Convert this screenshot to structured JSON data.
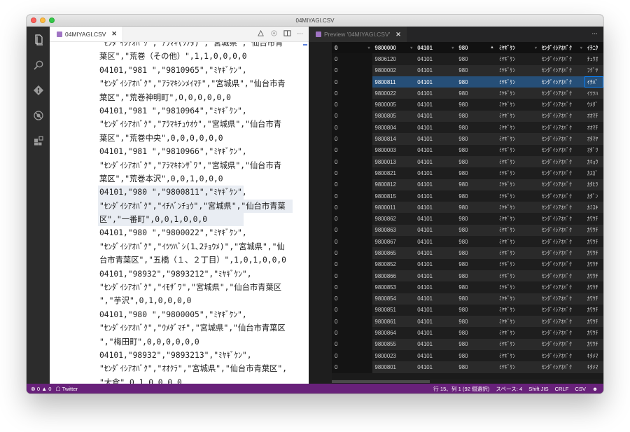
{
  "window": {
    "title": "04MIYAGI.CSV"
  },
  "activity_bar": {
    "icons": [
      "files-icon",
      "search-icon",
      "source-control-icon",
      "debug-icon",
      "extensions-icon"
    ]
  },
  "left_editor": {
    "tab_label": "04MIYAGI.CSV",
    "tab_close": "✕",
    "actions_more": "···",
    "lines": [
      "\"ｾﾝﾀﾞｲｼｱｵﾊﾞｸ\",\"ｱﾗﾏｷ(ｿﾉﾀ)\",\"宮城県\",\"仙台市青",
      "葉区\",\"荒巻（その他）\",1,1,0,0,0,0",
      "04101,\"981  \",\"9810965\",\"ﾐﾔｷﾞｹﾝ\",",
      "\"ｾﾝﾀﾞｲｼｱｵﾊﾞｸ\",\"ｱﾗﾏｷｼﾝﾒｲﾏﾁ\",\"宮城県\",\"仙台市青",
      "葉区\",\"荒巻神明町\",0,0,0,0,0,0",
      "04101,\"981  \",\"9810964\",\"ﾐﾔｷﾞｹﾝ\",",
      "\"ｾﾝﾀﾞｲｼｱｵﾊﾞｸ\",\"ｱﾗﾏｷﾁｭｳｵｳ\",\"宮城県\",\"仙台市青",
      "葉区\",\"荒巻中央\",0,0,0,0,0,0",
      "04101,\"981  \",\"9810966\",\"ﾐﾔｷﾞｹﾝ\",",
      "\"ｾﾝﾀﾞｲｼｱｵﾊﾞｸ\",\"ｱﾗﾏｷﾎﾝｻﾞﾜ\",\"宮城県\",\"仙台市青",
      "葉区\",\"荒巻本沢\",0,0,1,0,0,0",
      "04101,\"980  \",\"9800811\",\"ﾐﾔｷﾞｹﾝ\",",
      "\"ｾﾝﾀﾞｲｼｱｵﾊﾞｸ\",\"ｲﾁﾊﾞﾝﾁｮｳ\",\"宮城県\",\"仙台市青葉",
      "区\",\"一番町\",0,0,1,0,0,0",
      "04101,\"980  \",\"9800022\",\"ﾐﾔｷﾞｹﾝ\",",
      "\"ｾﾝﾀﾞｲｼｱｵﾊﾞｸ\",\"ｲﾂﾂﾊﾞｼ(1､2ﾁｮｳﾒ)\",\"宮城県\",\"仙",
      "台市青葉区\",\"五橋（１、２丁目）\",1,0,1,0,0,0",
      "04101,\"98932\",\"9893212\",\"ﾐﾔｷﾞｹﾝ\",",
      "\"ｾﾝﾀﾞｲｼｱｵﾊﾞｸ\",\"ｲﾓｻﾞﾜ\",\"宮城県\",\"仙台市青葉区",
      "\",\"芋沢\",0,1,0,0,0,0",
      "04101,\"980  \",\"9800005\",\"ﾐﾔｷﾞｹﾝ\",",
      "\"ｾﾝﾀﾞｲｼｱｵﾊﾞｸ\",\"ｳﾒﾀﾞﾏﾁ\",\"宮城県\",\"仙台市青葉区",
      "\",\"梅田町\",0,0,0,0,0,0",
      "04101,\"98932\",\"9893213\",\"ﾐﾔｷﾞｹﾝ\",",
      "\"ｾﾝﾀﾞｲｼｱｵﾊﾞｸ\",\"ｵｵｸﾗ\",\"宮城県\",\"仙台市青葉区\",",
      "\"大倉\",0,1,0,0,0,0",
      "04101,\"980  \",\"9800805\",\"ﾐﾔｷﾞｹﾝ\","
    ]
  },
  "right_editor": {
    "tab_label": "Preview '04MIYAGI.CSV'",
    "tab_close": "✕",
    "actions_more": "···",
    "headers": [
      "0",
      "9800000",
      "04101",
      "980",
      "ﾐﾔｷﾞｹﾝ",
      "ｾﾝﾀﾞｲｼｱｵﾊﾞｸ",
      "ｲﾁﾆｸ"
    ],
    "header_sort_glyph": "▾",
    "header_sort_active": "▲",
    "rows": [
      [
        "0",
        "9806120",
        "04101",
        "980",
        "ﾐﾔｷﾞｹﾝ",
        "ｾﾝﾀﾞｲｼｱｵﾊﾞｸ",
        "ﾁｭｳｵ"
      ],
      [
        "0",
        "9800002",
        "04101",
        "980",
        "ﾐﾔｷﾞｹﾝ",
        "ｾﾝﾀﾞｲｼｱｵﾊﾞｸ",
        "ﾌｸﾞﾔ"
      ],
      [
        "0",
        "9800811",
        "04101",
        "980",
        "ﾐﾔｷﾞｹﾝ",
        "ｾﾝﾀﾞｲｼｱｵﾊﾞｸ",
        "ｲﾁﾊﾞ"
      ],
      [
        "0",
        "9800022",
        "04101",
        "980",
        "ﾐﾔｷﾞｹﾝ",
        "ｾﾝﾀﾞｲｼｱｵﾊﾞｸ",
        "ｲﾂﾂﾊ"
      ],
      [
        "0",
        "9800005",
        "04101",
        "980",
        "ﾐﾔｷﾞｹﾝ",
        "ｾﾝﾀﾞｲｼｱｵﾊﾞｸ",
        "ｳﾒﾀﾞ"
      ],
      [
        "0",
        "9800805",
        "04101",
        "980",
        "ﾐﾔｷﾞｹﾝ",
        "ｾﾝﾀﾞｲｼｱｵﾊﾞｸ",
        "ｵｵﾏﾁ"
      ],
      [
        "0",
        "9800804",
        "04101",
        "980",
        "ﾐﾔｷﾞｹﾝ",
        "ｾﾝﾀﾞｲｼｱｵﾊﾞｸ",
        "ｵｵﾏﾁ"
      ],
      [
        "0",
        "9800814",
        "04101",
        "980",
        "ﾐﾔｷﾞｹﾝ",
        "ｾﾝﾀﾞｲｼｱｵﾊﾞｸ",
        "ｵﾀﾏﾔ"
      ],
      [
        "0",
        "9800003",
        "04101",
        "980",
        "ﾐﾔｷﾞｹﾝ",
        "ｾﾝﾀﾞｲｼｱｵﾊﾞｸ",
        "ｵﾀﾞﾜ"
      ],
      [
        "0",
        "9800013",
        "04101",
        "980",
        "ﾐﾔｷﾞｹﾝ",
        "ｾﾝﾀﾞｲｼｱｵﾊﾞｸ",
        "ｶｷｮｳ"
      ],
      [
        "0",
        "9800821",
        "04101",
        "980",
        "ﾐﾔｷﾞｹﾝ",
        "ｾﾝﾀﾞｲｼｱｵﾊﾞｸ",
        "ｶｽｶﾞ"
      ],
      [
        "0",
        "9800812",
        "04101",
        "980",
        "ﾐﾔｷﾞｹﾝ",
        "ｾﾝﾀﾞｲｼｱｵﾊﾞｸ",
        "ｶﾀﾋﾗ"
      ],
      [
        "0",
        "9800815",
        "04101",
        "980",
        "ﾐﾔｷﾞｹﾝ",
        "ｾﾝﾀﾞｲｼｱｵﾊﾞｸ",
        "ｶﾀﾞﾝ"
      ],
      [
        "0",
        "9800011",
        "04101",
        "980",
        "ﾐﾔｷﾞｹﾝ",
        "ｾﾝﾀﾞｲｼｱｵﾊﾞｸ",
        "ｶﾐｽｷ"
      ],
      [
        "0",
        "9800862",
        "04101",
        "980",
        "ﾐﾔｷﾞｹﾝ",
        "ｾﾝﾀﾞｲｼｱｵﾊﾞｸ",
        "ｶﾜｳﾁ"
      ],
      [
        "0",
        "9800863",
        "04101",
        "980",
        "ﾐﾔｷﾞｹﾝ",
        "ｾﾝﾀﾞｲｼｱｵﾊﾞｸ",
        "ｶﾜｳﾁ"
      ],
      [
        "0",
        "9800867",
        "04101",
        "980",
        "ﾐﾔｷﾞｹﾝ",
        "ｾﾝﾀﾞｲｼｱｵﾊﾞｸ",
        "ｶﾜｳﾁ"
      ],
      [
        "0",
        "9800865",
        "04101",
        "980",
        "ﾐﾔｷﾞｹﾝ",
        "ｾﾝﾀﾞｲｼｱｵﾊﾞｸ",
        "ｶﾜｳﾁ"
      ],
      [
        "0",
        "9800852",
        "04101",
        "980",
        "ﾐﾔｷﾞｹﾝ",
        "ｾﾝﾀﾞｲｼｱｵﾊﾞｸ",
        "ｶﾜｳﾁ"
      ],
      [
        "0",
        "9800866",
        "04101",
        "980",
        "ﾐﾔｷﾞｹﾝ",
        "ｾﾝﾀﾞｲｼｱｵﾊﾞｸ",
        "ｶﾜｳﾁ"
      ],
      [
        "0",
        "9800853",
        "04101",
        "980",
        "ﾐﾔｷﾞｹﾝ",
        "ｾﾝﾀﾞｲｼｱｵﾊﾞｸ",
        "ｶﾜｳﾁ"
      ],
      [
        "0",
        "9800854",
        "04101",
        "980",
        "ﾐﾔｷﾞｹﾝ",
        "ｾﾝﾀﾞｲｼｱｵﾊﾞｸ",
        "ｶﾜｳﾁ"
      ],
      [
        "0",
        "9800851",
        "04101",
        "980",
        "ﾐﾔｷﾞｹﾝ",
        "ｾﾝﾀﾞｲｼｱｵﾊﾞｸ",
        "ｶﾜｳﾁ"
      ],
      [
        "0",
        "9800861",
        "04101",
        "980",
        "ﾐﾔｷﾞｹﾝ",
        "ｾﾝﾀﾞｲｼｱｵﾊﾞｸ",
        "ｶﾜｳﾁ"
      ],
      [
        "0",
        "9800864",
        "04101",
        "980",
        "ﾐﾔｷﾞｹﾝ",
        "ｾﾝﾀﾞｲｼｱｵﾊﾞｸ",
        "ｶﾜｳﾁ"
      ],
      [
        "0",
        "9800855",
        "04101",
        "980",
        "ﾐﾔｷﾞｹﾝ",
        "ｾﾝﾀﾞｲｼｱｵﾊﾞｸ",
        "ｶﾜｳﾁ"
      ],
      [
        "0",
        "9800023",
        "04101",
        "980",
        "ﾐﾔｷﾞｹﾝ",
        "ｾﾝﾀﾞｲｼｱｵﾊﾞｸ",
        "ｷﾀﾒﾏ"
      ],
      [
        "0",
        "9800801",
        "04101",
        "980",
        "ﾐﾔｷﾞｹﾝ",
        "ｾﾝﾀﾞｲｼｱｵﾊﾞｸ",
        "ｷﾀﾒﾏ"
      ]
    ]
  },
  "status_bar": {
    "errors": "0",
    "warnings": "0",
    "twitter": "Twitter",
    "cursor": "行 15、列 1 (92 個選択)",
    "spaces": "スペース: 4",
    "encoding": "Shift JIS",
    "eol": "CRLF",
    "language": "CSV",
    "feedback_glyph": "☻"
  },
  "colors": {
    "status_bar": "#68217a",
    "selection": "#264f78",
    "file_icon": "#a074c4"
  }
}
